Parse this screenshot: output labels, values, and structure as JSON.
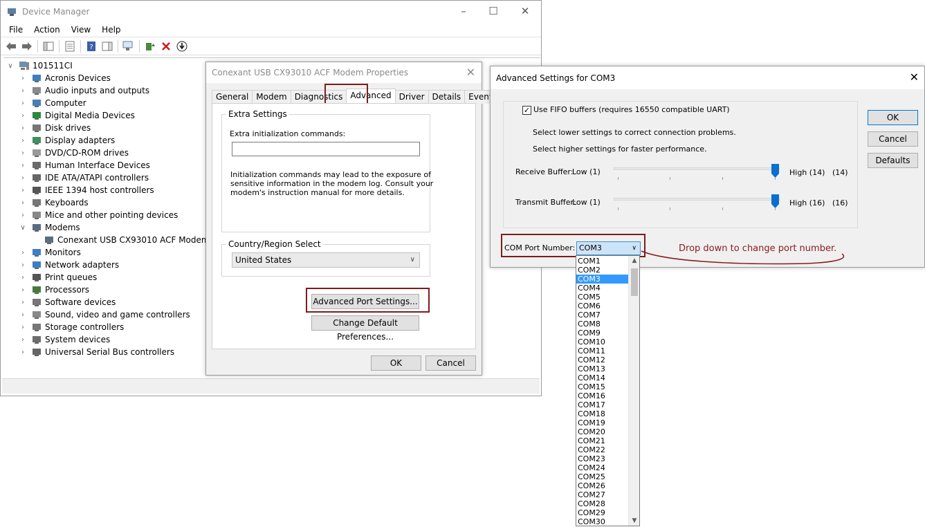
{
  "device_manager": {
    "title": "Device Manager",
    "menu": [
      "File",
      "Action",
      "View",
      "Help"
    ],
    "root": "101511CI",
    "tree": [
      {
        "label": "Acronis Devices",
        "icon": "monitor-icon"
      },
      {
        "label": "Audio inputs and outputs",
        "icon": "speaker-icon"
      },
      {
        "label": "Computer",
        "icon": "computer-icon"
      },
      {
        "label": "Digital Media Devices",
        "icon": "media-device-icon"
      },
      {
        "label": "Disk drives",
        "icon": "disk-drive-icon"
      },
      {
        "label": "Display adapters",
        "icon": "display-adapter-icon"
      },
      {
        "label": "DVD/CD-ROM drives",
        "icon": "dvd-drive-icon"
      },
      {
        "label": "Human Interface Devices",
        "icon": "hid-icon"
      },
      {
        "label": "IDE ATA/ATAPI controllers",
        "icon": "ide-controller-icon"
      },
      {
        "label": "IEEE 1394 host controllers",
        "icon": "ieee1394-icon"
      },
      {
        "label": "Keyboards",
        "icon": "keyboard-icon"
      },
      {
        "label": "Mice and other pointing devices",
        "icon": "mouse-icon"
      },
      {
        "label": "Modems",
        "icon": "modem-icon"
      },
      {
        "label": "Conexant USB CX93010 ACF Modem",
        "icon": "modem-device-icon"
      },
      {
        "label": "Monitors",
        "icon": "monitor-icon"
      },
      {
        "label": "Network adapters",
        "icon": "network-adapter-icon"
      },
      {
        "label": "Print queues",
        "icon": "printer-icon"
      },
      {
        "label": "Processors",
        "icon": "processor-icon"
      },
      {
        "label": "Software devices",
        "icon": "software-device-icon"
      },
      {
        "label": "Sound, video and game controllers",
        "icon": "sound-icon"
      },
      {
        "label": "Storage controllers",
        "icon": "storage-controller-icon"
      },
      {
        "label": "System devices",
        "icon": "system-device-icon"
      },
      {
        "label": "Universal Serial Bus controllers",
        "icon": "usb-icon"
      }
    ]
  },
  "properties": {
    "title": "Conexant USB CX93010 ACF Modem Properties",
    "tabs": [
      "General",
      "Modem",
      "Diagnostics",
      "Advanced",
      "Driver",
      "Details",
      "Events"
    ],
    "active_tab": "Advanced",
    "extra_settings_legend": "Extra Settings",
    "extra_init_label": "Extra initialization commands:",
    "extra_init_value": "",
    "info_line1": "Initialization commands may lead to the exposure of",
    "info_line2": "sensitive information in the modem log. Consult your",
    "info_line3": "modem's instruction manual for more details.",
    "country_legend": "Country/Region Select",
    "country_value": "United States",
    "advanced_port_button": "Advanced Port Settings...",
    "change_default_button": "Change Default Preferences...",
    "ok": "OK",
    "cancel": "Cancel"
  },
  "advanced": {
    "title": "Advanced Settings for COM3",
    "fifo_label": "Use FIFO buffers (requires 16550 compatible UART)",
    "fifo_checked": true,
    "hint_lower": "Select lower settings to correct connection problems.",
    "hint_higher": "Select higher settings for faster performance.",
    "receive_label": "Receive Buffer:",
    "receive_low": "Low (1)",
    "receive_high": "High (14)",
    "receive_value": "(14)",
    "transmit_label": "Transmit Buffer:",
    "transmit_low": "Low (1)",
    "transmit_high": "High (16)",
    "transmit_value": "(16)",
    "com_port_label": "COM Port Number:",
    "com_port_value": "COM3",
    "ok": "OK",
    "cancel": "Cancel",
    "defaults": "Defaults"
  },
  "com_options": [
    "COM1",
    "COM2",
    "COM3",
    "COM4",
    "COM5",
    "COM6",
    "COM7",
    "COM8",
    "COM9",
    "COM10",
    "COM11",
    "COM12",
    "COM13",
    "COM14",
    "COM15",
    "COM16",
    "COM17",
    "COM18",
    "COM19",
    "COM20",
    "COM21",
    "COM22",
    "COM23",
    "COM24",
    "COM25",
    "COM26",
    "COM27",
    "COM28",
    "COM29",
    "COM30"
  ],
  "com_selected": "COM3",
  "annotation": "Drop down to change port number.",
  "colors": {
    "highlight_box": "#7b1c1c",
    "selection": "#3399ff",
    "slider_thumb": "#0a6fd0"
  }
}
